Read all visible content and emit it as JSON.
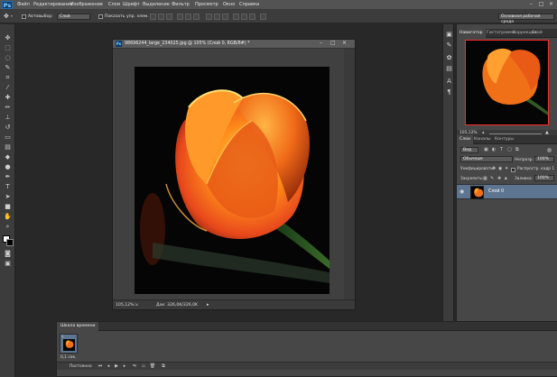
{
  "app": {
    "logo": "Ps"
  },
  "menu": [
    "Файл",
    "Редактирование",
    "Изображение",
    "Слои",
    "Шрифт",
    "Выделение",
    "Фильтр",
    "Просмотр",
    "Окно",
    "Справка"
  ],
  "options": {
    "autoselect_label": "Автовыбор:",
    "autoselect_value": "Слой",
    "show_controls_label": "Показать упр. элем.",
    "workspace": "Основная рабочая среда"
  },
  "document": {
    "title": "98696244_large_234025.jpg @ 105% (Слой 0, RGB/8#) *",
    "zoom": "105,12%",
    "doc_info": "Док: 326,0K/326,0K"
  },
  "navigator": {
    "tabs": [
      "Навигатор",
      "Гистограмма",
      "Коррекция",
      "Свой"
    ],
    "zoom": "105,12%"
  },
  "layers": {
    "tabs": [
      "Слои",
      "Каналы",
      "Контуры"
    ],
    "kind": "Вид",
    "blend_mode": "Обычные",
    "opacity_label": "Непрозр.:",
    "opacity": "100%",
    "unify_label": "Унифицировать:",
    "propagate_label": "Распростр. кадр 1",
    "lock_label": "Закрепить:",
    "fill_label": "Заливка:",
    "fill": "100%",
    "items": [
      {
        "name": "Слой 0",
        "visible": true
      }
    ]
  },
  "timeline": {
    "title": "Шкала времени",
    "frame_delay": "0,1 сек.",
    "loop": "Постоянно"
  },
  "colors": {
    "accent": "#0a3d6e",
    "selected_layer": "#5d7590",
    "nav_frame": "#ff2a2a"
  }
}
